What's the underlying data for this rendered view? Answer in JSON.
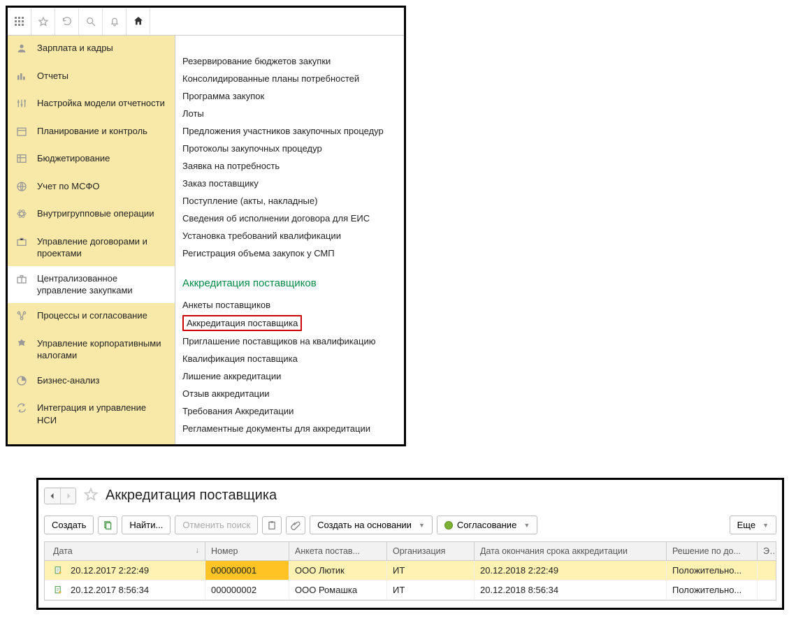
{
  "sidebar": {
    "items": [
      {
        "label": "Зарплата и кадры"
      },
      {
        "label": "Отчеты"
      },
      {
        "label": "Настройка модели отчетности"
      },
      {
        "label": "Планирование и контроль"
      },
      {
        "label": "Бюджетирование"
      },
      {
        "label": "Учет по МСФО"
      },
      {
        "label": "Внутригрупповые операции"
      },
      {
        "label": "Управление договорами и проектами"
      },
      {
        "label": "Централизованное управление закупками"
      },
      {
        "label": "Процессы и согласование"
      },
      {
        "label": "Управление корпоративными налогами"
      },
      {
        "label": "Бизнес-анализ"
      },
      {
        "label": "Интеграция и управление НСИ"
      }
    ]
  },
  "menu": {
    "group1": [
      "Резервирование бюджетов закупки",
      "Консолидированные планы потребностей",
      "Программа закупок",
      "Лоты",
      "Предложения участников закупочных процедур",
      "Протоколы закупочных процедур",
      "Заявка на потребность",
      "Заказ поставщику",
      "Поступление (акты, накладные)",
      "Сведения об исполнении договора для ЕИС",
      "Установка требований квалификации",
      "Регистрация объема закупок у СМП"
    ],
    "section_head": "Аккредитация поставщиков",
    "group2": [
      "Анкеты поставщиков",
      "Аккредитация поставщика",
      "Приглашение поставщиков на квалификацию",
      "Квалификация поставщика",
      "Лишение аккредитации",
      "Отзыв аккредитации",
      "Требования Аккредитации",
      "Регламентные документы для аккредитации"
    ]
  },
  "list": {
    "title": "Аккредитация поставщика",
    "buttons": {
      "create": "Создать",
      "find": "Найти...",
      "cancel_search": "Отменить поиск",
      "create_based": "Создать на основании",
      "agreement": "Согласование",
      "more": "Еще"
    },
    "columns": [
      "Дата",
      "Номер",
      "Анкета постав...",
      "Организация",
      "Дата окончания срока аккредитации",
      "Решение по до...",
      "Это п"
    ],
    "rows": [
      {
        "date": "20.12.2017 2:22:49",
        "num": "000000001",
        "anketa": "ООО Лютик",
        "org": "ИТ",
        "end": "20.12.2018 2:22:49",
        "rez": "Положительно...",
        "eto": ""
      },
      {
        "date": "20.12.2017 8:56:34",
        "num": "000000002",
        "anketa": "ООО Ромашка",
        "org": "ИТ",
        "end": "20.12.2018 8:56:34",
        "rez": "Положительно...",
        "eto": ""
      }
    ]
  }
}
